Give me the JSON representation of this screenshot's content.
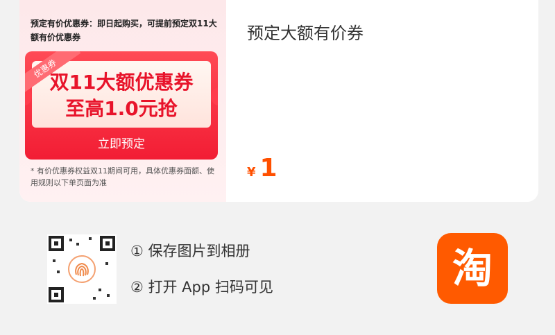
{
  "promo": {
    "description": "预定有价优惠券：即日起购买，可提前预定双11大额有价优惠券",
    "tag": "优惠券",
    "coupon_title": "双11大额优惠券",
    "coupon_subtitle": "至高1.0元抢",
    "button_label": "立即预定",
    "note": "* 有价优惠券权益双11期间可用，具体优惠券面额、使用规则以下单页面为准"
  },
  "product": {
    "title": "预定大额有价券",
    "currency": "¥",
    "price": "1"
  },
  "share": {
    "step1": "① 保存图片到相册",
    "step2": "② 打开 App 扫码可见",
    "app_icon_glyph": "淘"
  },
  "colors": {
    "accent": "#ff5000",
    "coupon_red": "#f21d34",
    "taobao_orange": "#ff5a00"
  }
}
